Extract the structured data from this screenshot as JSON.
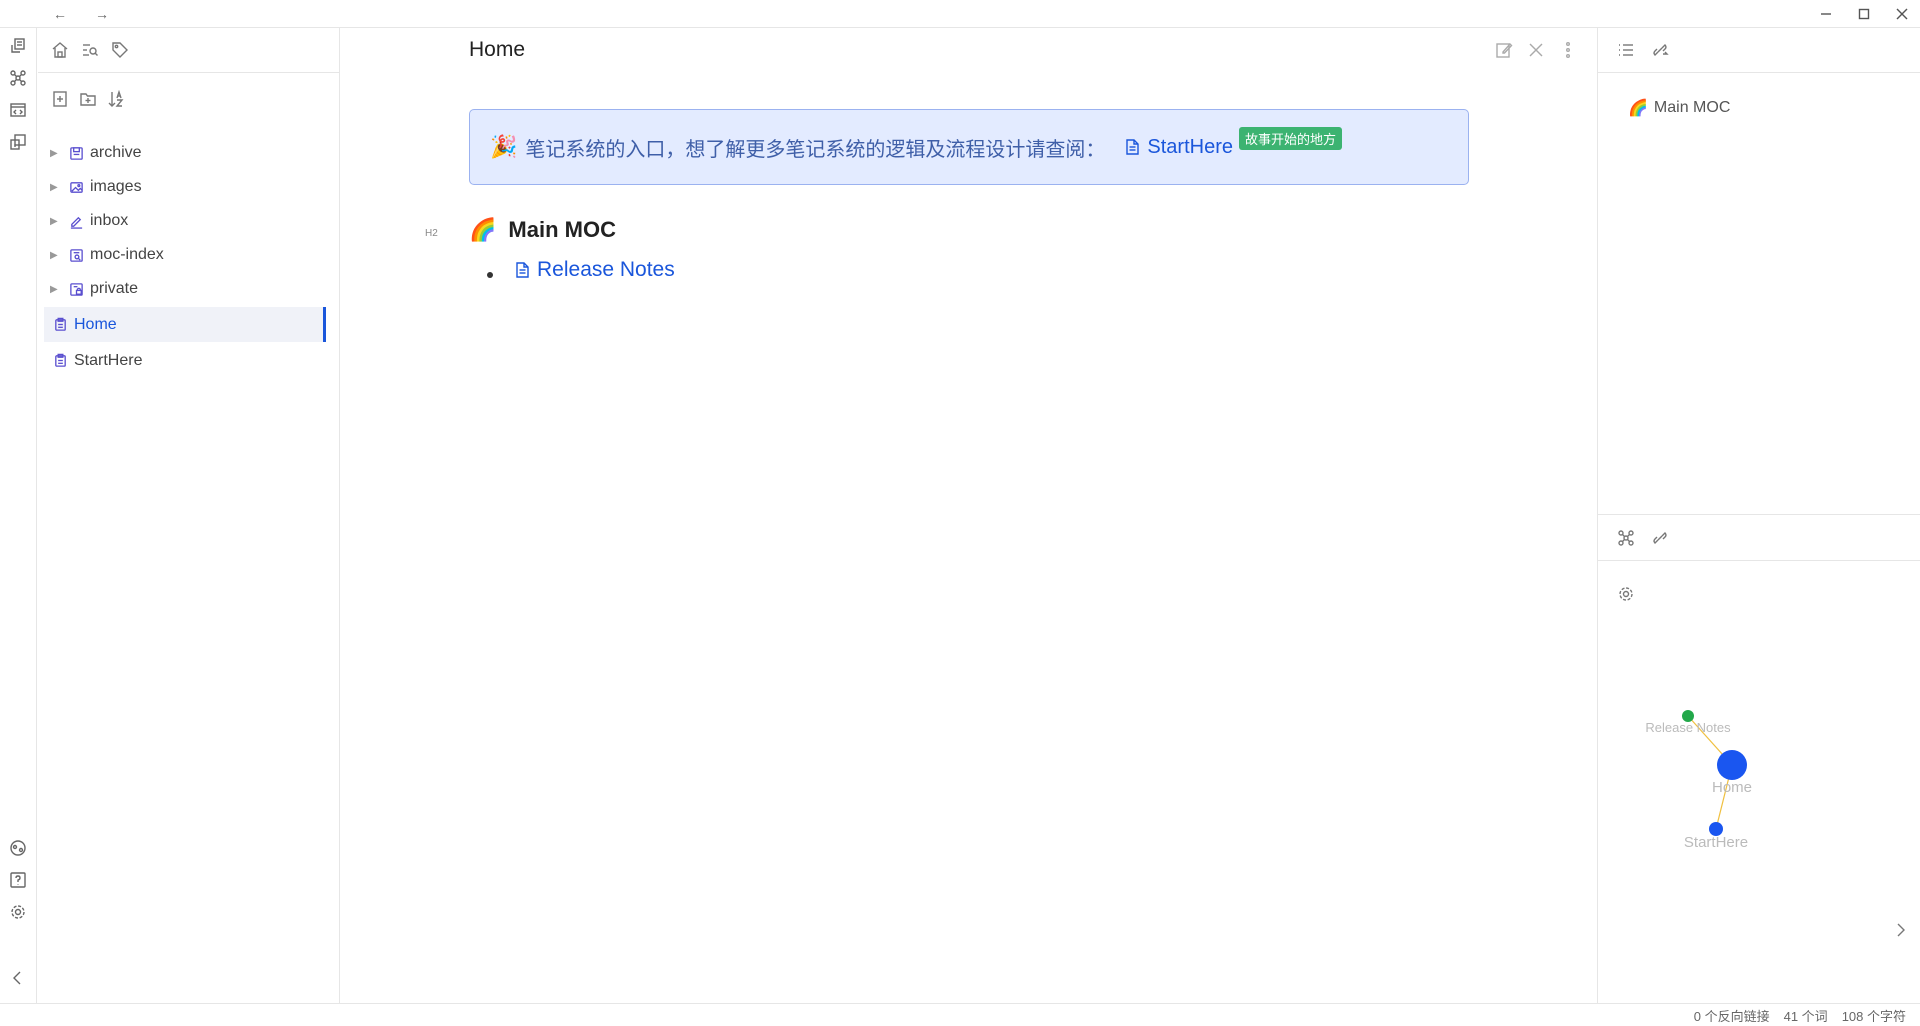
{
  "window": {
    "nav_back": "←",
    "nav_forward": "→"
  },
  "ribbon": {
    "icons": [
      "open-quick-switcher-icon",
      "graph-view-icon",
      "templates-icon",
      "daily-notes-icon",
      "vault-switcher-icon",
      "help-icon",
      "settings-icon",
      "collapse-sidebar-icon"
    ]
  },
  "file_explorer": {
    "tabs": [
      "home-icon",
      "search-icon",
      "tag-icon"
    ],
    "actions": [
      "new-note-icon",
      "new-folder-icon",
      "sort-icon"
    ],
    "folders": [
      {
        "label": "archive"
      },
      {
        "label": "images"
      },
      {
        "label": "inbox"
      },
      {
        "label": "moc-index"
      },
      {
        "label": "private"
      }
    ],
    "files": [
      {
        "label": "Home",
        "active": true
      },
      {
        "label": "StartHere",
        "active": false
      }
    ]
  },
  "editor": {
    "title": "Home",
    "callout": {
      "emoji": "🎉",
      "text": "笔记系统的入口，想了解更多笔记系统的逻辑及流程设计请查阅：",
      "link_label": "StartHere",
      "badge": "故事开始的地方"
    },
    "heading": {
      "marker": "H2",
      "emoji": "🌈",
      "text": "Main MOC"
    },
    "list": [
      {
        "label": "Release Notes"
      }
    ]
  },
  "outline": {
    "items": [
      {
        "emoji": "🌈",
        "label": "Main MOC"
      }
    ]
  },
  "graph": {
    "nodes": [
      {
        "label": "Release Notes",
        "color": "#22a84a"
      },
      {
        "label": "Home",
        "color": "#1a56f0"
      },
      {
        "label": "StartHere",
        "color": "#1a56f0"
      }
    ],
    "edge_color": "#f0c040"
  },
  "status": {
    "backlinks": "0 个反向链接",
    "words": "41 个词",
    "chars": "108 个字符"
  },
  "colors": {
    "accent": "#1a56db",
    "callout_bg": "#e3ebff",
    "badge_bg": "#3cb371"
  }
}
